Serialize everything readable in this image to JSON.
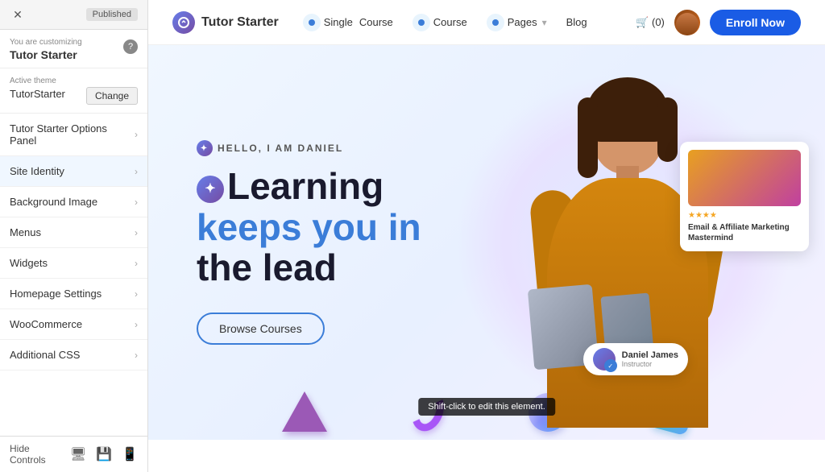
{
  "panel": {
    "status": "Published",
    "customizing_label": "You are customizing",
    "theme_name": "Tutor Starter",
    "active_theme_label": "Active theme",
    "active_theme_name": "TutorStarter",
    "change_button": "Change",
    "menu_items": [
      {
        "id": "tutor-starter-options",
        "label": "Tutor Starter Options Panel"
      },
      {
        "id": "site-identity",
        "label": "Site Identity"
      },
      {
        "id": "background-image",
        "label": "Background Image"
      },
      {
        "id": "menus",
        "label": "Menus"
      },
      {
        "id": "widgets",
        "label": "Widgets"
      },
      {
        "id": "homepage-settings",
        "label": "Homepage Settings"
      },
      {
        "id": "woocommerce",
        "label": "WooCommerce"
      },
      {
        "id": "additional-css",
        "label": "Additional CSS"
      }
    ],
    "hide_controls_label": "Hide Controls"
  },
  "navbar": {
    "logo_text": "Tutor Starter",
    "links": [
      {
        "label": "Single Course",
        "has_icon": true
      },
      {
        "label": "Course",
        "has_icon": true
      },
      {
        "label": "Pages",
        "has_dropdown": true
      },
      {
        "label": "Blog"
      }
    ],
    "cart_label": "(0)",
    "enroll_button": "Enroll Now"
  },
  "hero": {
    "hello_text": "HELLO, I AM DANIEL",
    "title_line1": "Learning",
    "title_line2": "keeps you in",
    "title_line3": "the lead",
    "browse_button": "Browse Courses",
    "card": {
      "stars": "★★★★",
      "title": "Email & Affiliate Marketing Mastermind"
    },
    "instructor": {
      "name": "Daniel James",
      "title": "Instructor"
    }
  },
  "tooltip": {
    "text": "Shift-click to edit this element."
  }
}
